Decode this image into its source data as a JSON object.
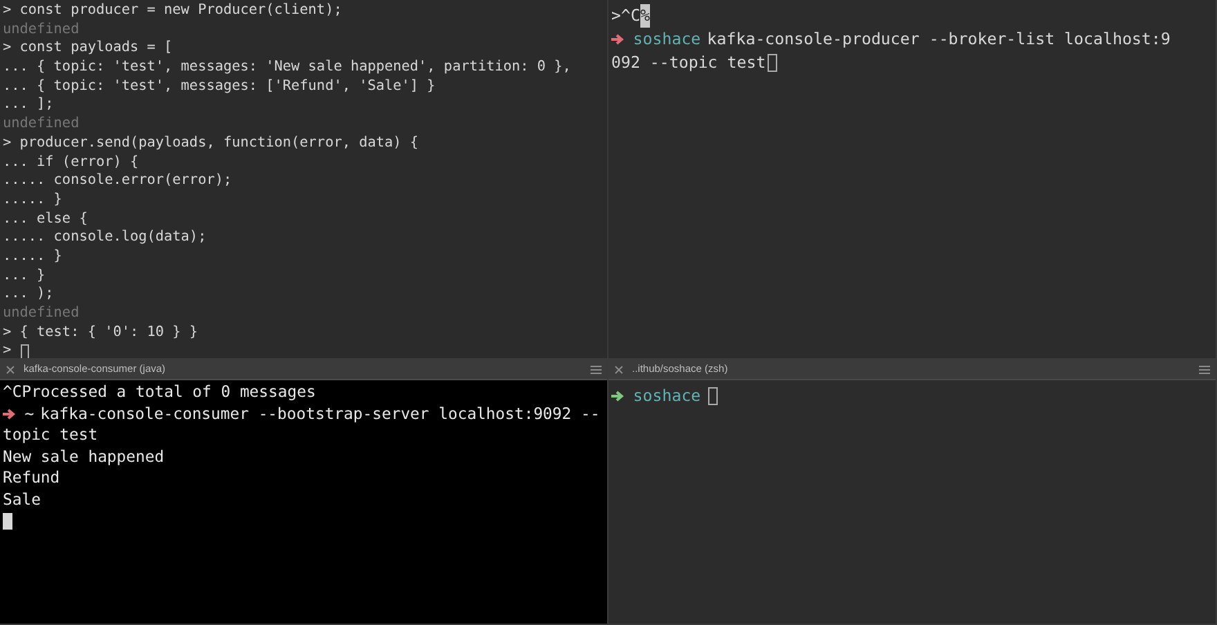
{
  "panes": [
    {
      "kind": "repl",
      "lines": [
        {
          "kind": "code",
          "text": "> const producer = new Producer(client);"
        },
        {
          "kind": "dim",
          "text": "undefined"
        },
        {
          "kind": "code",
          "text": "> const payloads = ["
        },
        {
          "kind": "code",
          "text": "... { topic: 'test', messages: 'New sale happened', partition: 0 },"
        },
        {
          "kind": "code",
          "text": "... { topic: 'test', messages: ['Refund', 'Sale'] }"
        },
        {
          "kind": "code",
          "text": "... ];"
        },
        {
          "kind": "dim",
          "text": "undefined"
        },
        {
          "kind": "code",
          "text": "> producer.send(payloads, function(error, data) {"
        },
        {
          "kind": "code",
          "text": "... if (error) {"
        },
        {
          "kind": "code",
          "text": "..... console.error(error);"
        },
        {
          "kind": "code",
          "text": "..... }"
        },
        {
          "kind": "code",
          "text": "... else {"
        },
        {
          "kind": "code",
          "text": "..... console.log(data);"
        },
        {
          "kind": "code",
          "text": "..... }"
        },
        {
          "kind": "code",
          "text": "... }"
        },
        {
          "kind": "code",
          "text": "... );"
        },
        {
          "kind": "dim",
          "text": "undefined"
        },
        {
          "kind": "code",
          "text": "> { test: { '0': 10 } }"
        },
        {
          "kind": "code",
          "text": "> ",
          "cursor": true,
          "cursor_filled": false
        }
      ]
    },
    {
      "kind": "shell",
      "lines": [
        {
          "kind": "code",
          "text": ">^C",
          "cursor": true,
          "cursor_filled": true,
          "cursor_text": "%"
        },
        {
          "kind": "prompt",
          "exit_ok": false,
          "dir": "soshace",
          "text": "kafka-console-producer --broker-list localhost:9"
        },
        {
          "kind": "code",
          "text": "092 --topic test",
          "cursor": true,
          "cursor_filled": false
        }
      ]
    },
    {
      "kind": "terminal",
      "tab": "kafka-console-consumer (java)",
      "lines": [
        {
          "kind": "code",
          "text": "^CProcessed a total of 0 messages"
        },
        {
          "kind": "prompt",
          "exit_ok": false,
          "dir": "~",
          "text": "kafka-console-consumer --bootstrap-server localhost:9092 --"
        },
        {
          "kind": "code",
          "text": "topic test"
        },
        {
          "kind": "code",
          "text": "New sale happened"
        },
        {
          "kind": "code",
          "text": "Refund"
        },
        {
          "kind": "code",
          "text": "Sale"
        },
        {
          "kind": "code",
          "cursor": true,
          "cursor_filled": true
        }
      ]
    },
    {
      "kind": "shell",
      "tab": "..ithub/soshace (zsh)",
      "lines": [
        {
          "kind": "prompt",
          "exit_ok": true,
          "dir": "soshace",
          "cursor": true,
          "cursor_filled": false
        }
      ]
    }
  ]
}
